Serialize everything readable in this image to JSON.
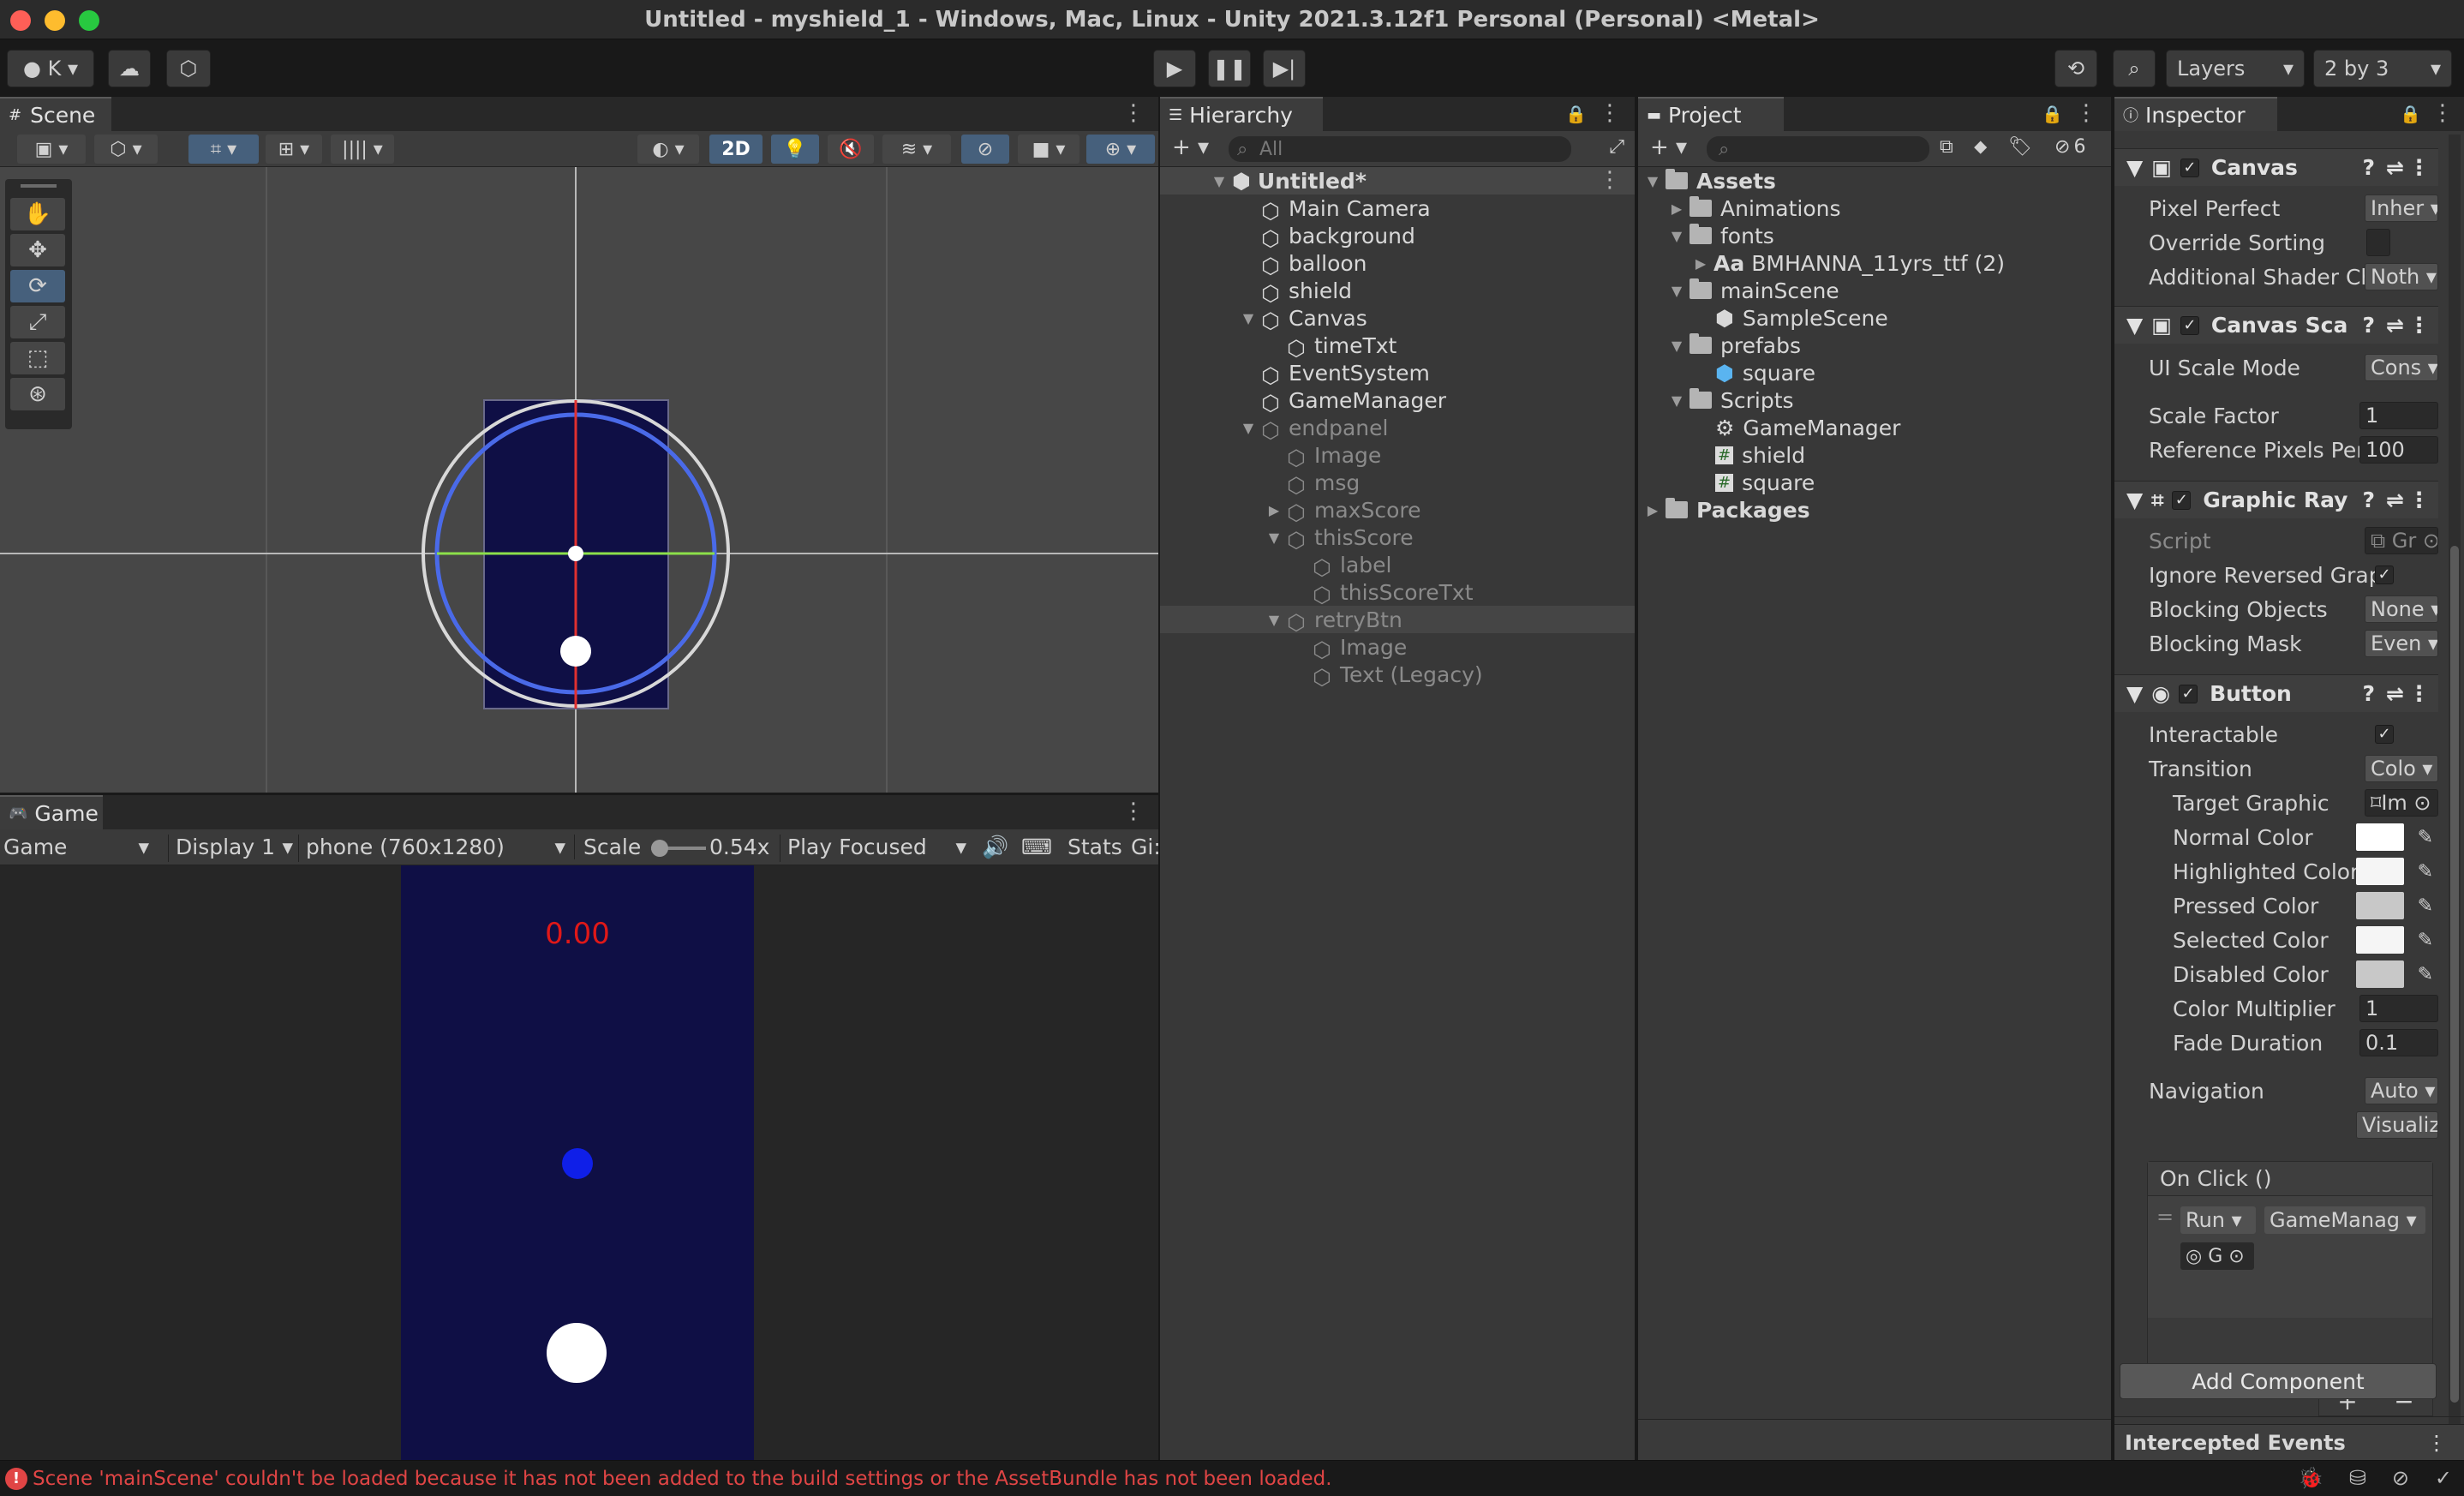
{
  "window": {
    "title": "Untitled - myshield_1 - Windows, Mac, Linux - Unity 2021.3.12f1 Personal (Personal) <Metal>"
  },
  "toolbar": {
    "account": "K",
    "layers": "Layers",
    "layout": "2 by 3"
  },
  "scene": {
    "tab": "Scene",
    "mode2d": "2D"
  },
  "game": {
    "tab": "Game",
    "view": "Game",
    "display": "Display 1",
    "resolution": "phone (760x1280)",
    "scale_label": "Scale",
    "scale_value": "0.54x",
    "play_mode": "Play Focused",
    "stats": "Stats",
    "gizmos": "Gi:",
    "time_text": "0.00"
  },
  "hierarchy": {
    "tab": "Hierarchy",
    "search_placeholder": "All",
    "scene_name": "Untitled*",
    "items": [
      "Main Camera",
      "background",
      "balloon",
      "shield",
      "Canvas",
      "timeTxt",
      "EventSystem",
      "GameManager",
      "endpanel",
      "Image",
      "msg",
      "maxScore",
      "thisScore",
      "label",
      "thisScoreTxt",
      "retryBtn",
      "Image",
      "Text (Legacy)"
    ]
  },
  "project": {
    "tab": "Project",
    "hidden_count": "6",
    "items": [
      "Assets",
      "Animations",
      "fonts",
      "BMHANNA_11yrs_ttf (2)",
      "mainScene",
      "SampleScene",
      "prefabs",
      "square",
      "Scripts",
      "GameManager",
      "shield",
      "square",
      "Packages"
    ]
  },
  "inspector": {
    "tab": "Inspector",
    "canvas": {
      "title": "Canvas",
      "pixel_perfect": "Pixel Perfect",
      "pixel_perfect_val": "Inher",
      "override_sorting": "Override Sorting",
      "shader_channels": "Additional Shader Ch",
      "shader_channels_val": "Noth"
    },
    "canvas_scaler": {
      "title": "Canvas Sca",
      "ui_scale_mode": "UI Scale Mode",
      "ui_scale_mode_val": "Cons",
      "scale_factor": "Scale Factor",
      "scale_factor_val": "1",
      "ref_ppu": "Reference Pixels Per",
      "ref_ppu_val": "100"
    },
    "raycaster": {
      "title": "Graphic Ray",
      "script": "Script",
      "script_val": "Gr",
      "ignore_reversed": "Ignore Reversed Grap",
      "blocking_objects": "Blocking Objects",
      "blocking_objects_val": "None",
      "blocking_mask": "Blocking Mask",
      "blocking_mask_val": "Even"
    },
    "button": {
      "title": "Button",
      "interactable": "Interactable",
      "transition": "Transition",
      "transition_val": "Colo",
      "target_graphic": "Target Graphic",
      "target_graphic_val": "Im",
      "normal": "Normal Color",
      "highlighted": "Highlighted Color",
      "pressed": "Pressed Color",
      "selected": "Selected Color",
      "disabled": "Disabled Color",
      "multiplier": "Color Multiplier",
      "multiplier_val": "1",
      "fade": "Fade Duration",
      "fade_val": "0.1",
      "navigation": "Navigation",
      "navigation_val": "Auto",
      "visualize": "Visualiz",
      "onclick": "On Click ()",
      "runtime": "Run",
      "target": "GameManag",
      "obj": "G"
    },
    "add_component": "Add Component",
    "intercepted": "Intercepted Events"
  },
  "status": {
    "message": "Scene 'mainScene' couldn't be loaded because it has not been added to the build settings or the AssetBundle has not been loaded."
  },
  "colors": {
    "accent": "#46607c",
    "error": "#e04545",
    "game_bg": "#0f0f45",
    "time_text": "#e01818"
  }
}
